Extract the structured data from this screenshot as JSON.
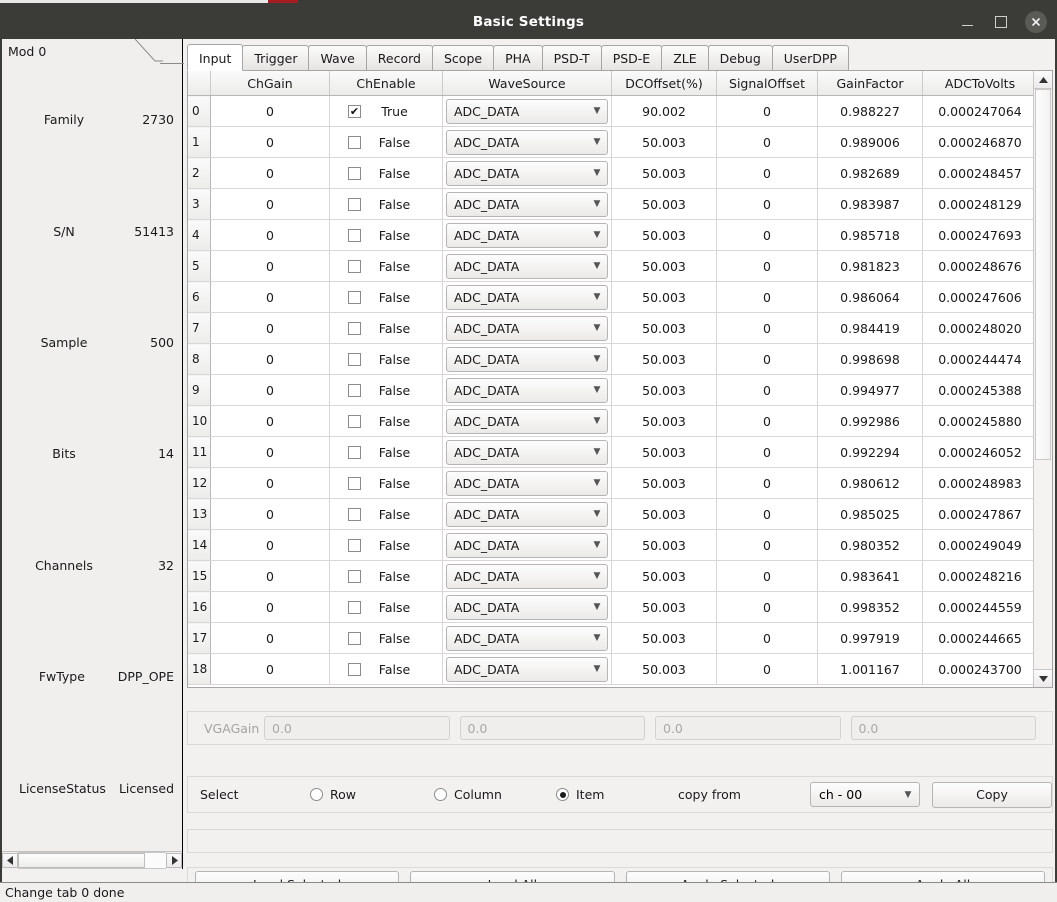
{
  "window": {
    "title": "Basic Settings",
    "minimize_label": "–",
    "maximize_label": "□",
    "close_label": "✕"
  },
  "sidebar": {
    "tab_label": "Mod 0",
    "rows": [
      {
        "key": "Family",
        "value": "2730"
      },
      {
        "key": "S/N",
        "value": "51413"
      },
      {
        "key": "Sample",
        "value": "500"
      },
      {
        "key": "Bits",
        "value": "14"
      },
      {
        "key": "Channels",
        "value": "32"
      },
      {
        "key": "FwType",
        "value": "DPP_OPE"
      },
      {
        "key": "LicenseStatus",
        "value": "Licensed"
      }
    ]
  },
  "tabs": [
    {
      "label": "Input",
      "active": true
    },
    {
      "label": "Trigger",
      "active": false
    },
    {
      "label": "Wave",
      "active": false
    },
    {
      "label": "Record",
      "active": false
    },
    {
      "label": "Scope",
      "active": false
    },
    {
      "label": "PHA",
      "active": false
    },
    {
      "label": "PSD-T",
      "active": false
    },
    {
      "label": "PSD-E",
      "active": false
    },
    {
      "label": "ZLE",
      "active": false
    },
    {
      "label": "Debug",
      "active": false
    },
    {
      "label": "UserDPP",
      "active": false
    }
  ],
  "table": {
    "columns": [
      "",
      "ChGain",
      "ChEnable",
      "WaveSource",
      "DCOffset(%)",
      "SignalOffset",
      "GainFactor",
      "ADCToVolts"
    ],
    "rows": [
      {
        "idx": "0",
        "chgain": "0",
        "enabled": true,
        "enable_text": "True",
        "wavesource": "ADC_DATA",
        "dcoffset": "90.002",
        "signaloffset": "0",
        "gainfactor": "0.988227",
        "adctovolts": "0.000247064"
      },
      {
        "idx": "1",
        "chgain": "0",
        "enabled": false,
        "enable_text": "False",
        "wavesource": "ADC_DATA",
        "dcoffset": "50.003",
        "signaloffset": "0",
        "gainfactor": "0.989006",
        "adctovolts": "0.000246870"
      },
      {
        "idx": "2",
        "chgain": "0",
        "enabled": false,
        "enable_text": "False",
        "wavesource": "ADC_DATA",
        "dcoffset": "50.003",
        "signaloffset": "0",
        "gainfactor": "0.982689",
        "adctovolts": "0.000248457"
      },
      {
        "idx": "3",
        "chgain": "0",
        "enabled": false,
        "enable_text": "False",
        "wavesource": "ADC_DATA",
        "dcoffset": "50.003",
        "signaloffset": "0",
        "gainfactor": "0.983987",
        "adctovolts": "0.000248129"
      },
      {
        "idx": "4",
        "chgain": "0",
        "enabled": false,
        "enable_text": "False",
        "wavesource": "ADC_DATA",
        "dcoffset": "50.003",
        "signaloffset": "0",
        "gainfactor": "0.985718",
        "adctovolts": "0.000247693"
      },
      {
        "idx": "5",
        "chgain": "0",
        "enabled": false,
        "enable_text": "False",
        "wavesource": "ADC_DATA",
        "dcoffset": "50.003",
        "signaloffset": "0",
        "gainfactor": "0.981823",
        "adctovolts": "0.000248676"
      },
      {
        "idx": "6",
        "chgain": "0",
        "enabled": false,
        "enable_text": "False",
        "wavesource": "ADC_DATA",
        "dcoffset": "50.003",
        "signaloffset": "0",
        "gainfactor": "0.986064",
        "adctovolts": "0.000247606"
      },
      {
        "idx": "7",
        "chgain": "0",
        "enabled": false,
        "enable_text": "False",
        "wavesource": "ADC_DATA",
        "dcoffset": "50.003",
        "signaloffset": "0",
        "gainfactor": "0.984419",
        "adctovolts": "0.000248020"
      },
      {
        "idx": "8",
        "chgain": "0",
        "enabled": false,
        "enable_text": "False",
        "wavesource": "ADC_DATA",
        "dcoffset": "50.003",
        "signaloffset": "0",
        "gainfactor": "0.998698",
        "adctovolts": "0.000244474"
      },
      {
        "idx": "9",
        "chgain": "0",
        "enabled": false,
        "enable_text": "False",
        "wavesource": "ADC_DATA",
        "dcoffset": "50.003",
        "signaloffset": "0",
        "gainfactor": "0.994977",
        "adctovolts": "0.000245388"
      },
      {
        "idx": "10",
        "chgain": "0",
        "enabled": false,
        "enable_text": "False",
        "wavesource": "ADC_DATA",
        "dcoffset": "50.003",
        "signaloffset": "0",
        "gainfactor": "0.992986",
        "adctovolts": "0.000245880"
      },
      {
        "idx": "11",
        "chgain": "0",
        "enabled": false,
        "enable_text": "False",
        "wavesource": "ADC_DATA",
        "dcoffset": "50.003",
        "signaloffset": "0",
        "gainfactor": "0.992294",
        "adctovolts": "0.000246052"
      },
      {
        "idx": "12",
        "chgain": "0",
        "enabled": false,
        "enable_text": "False",
        "wavesource": "ADC_DATA",
        "dcoffset": "50.003",
        "signaloffset": "0",
        "gainfactor": "0.980612",
        "adctovolts": "0.000248983"
      },
      {
        "idx": "13",
        "chgain": "0",
        "enabled": false,
        "enable_text": "False",
        "wavesource": "ADC_DATA",
        "dcoffset": "50.003",
        "signaloffset": "0",
        "gainfactor": "0.985025",
        "adctovolts": "0.000247867"
      },
      {
        "idx": "14",
        "chgain": "0",
        "enabled": false,
        "enable_text": "False",
        "wavesource": "ADC_DATA",
        "dcoffset": "50.003",
        "signaloffset": "0",
        "gainfactor": "0.980352",
        "adctovolts": "0.000249049"
      },
      {
        "idx": "15",
        "chgain": "0",
        "enabled": false,
        "enable_text": "False",
        "wavesource": "ADC_DATA",
        "dcoffset": "50.003",
        "signaloffset": "0",
        "gainfactor": "0.983641",
        "adctovolts": "0.000248216"
      },
      {
        "idx": "16",
        "chgain": "0",
        "enabled": false,
        "enable_text": "False",
        "wavesource": "ADC_DATA",
        "dcoffset": "50.003",
        "signaloffset": "0",
        "gainfactor": "0.998352",
        "adctovolts": "0.000244559"
      },
      {
        "idx": "17",
        "chgain": "0",
        "enabled": false,
        "enable_text": "False",
        "wavesource": "ADC_DATA",
        "dcoffset": "50.003",
        "signaloffset": "0",
        "gainfactor": "0.997919",
        "adctovolts": "0.000244665"
      },
      {
        "idx": "18",
        "chgain": "0",
        "enabled": false,
        "enable_text": "False",
        "wavesource": "ADC_DATA",
        "dcoffset": "50.003",
        "signaloffset": "0",
        "gainfactor": "1.001167",
        "adctovolts": "0.000243700"
      }
    ]
  },
  "vga": {
    "label": "VGAGain",
    "fields": [
      "0.0",
      "0.0",
      "0.0",
      "0.0"
    ]
  },
  "select": {
    "label": "Select",
    "options": [
      {
        "label": "Row",
        "selected": false
      },
      {
        "label": "Column",
        "selected": false
      },
      {
        "label": "Item",
        "selected": true
      }
    ],
    "copy_from_label": "copy from",
    "channel_value": "ch - 00",
    "copy_button": "Copy"
  },
  "actions": {
    "load_selected": "Load Selected",
    "load_all": "Load All",
    "apply_selected": "Apply Selected",
    "apply_all": "Apply All"
  },
  "status": {
    "text": "Change tab 0 done"
  },
  "colors": {
    "titlebar_bg": "#3b3b38",
    "panel_bg": "#f2f1f0",
    "accent_red": "#a51d23"
  }
}
